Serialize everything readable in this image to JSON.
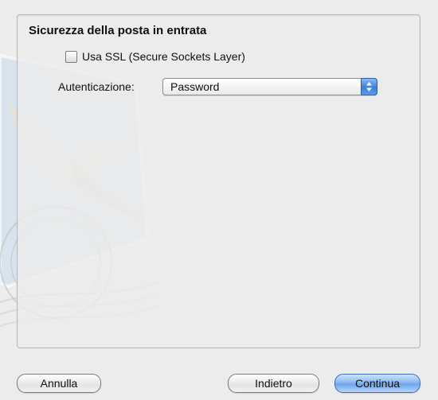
{
  "section": {
    "title": "Sicurezza della posta in entrata"
  },
  "ssl": {
    "label": "Usa SSL (Secure Sockets Layer)",
    "checked": false
  },
  "auth": {
    "label": "Autenticazione:",
    "value": "Password"
  },
  "buttons": {
    "cancel": "Annulla",
    "back": "Indietro",
    "continue": "Continua"
  },
  "colors": {
    "default_button": "#6ea4ea",
    "window_bg": "#ececec"
  }
}
